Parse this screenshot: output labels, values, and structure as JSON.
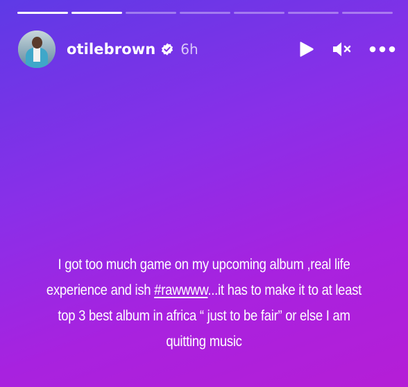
{
  "story": {
    "progress": {
      "segments": 7,
      "completed": 1,
      "active_index": 1,
      "active_fraction": 0.95
    },
    "user": {
      "username": "otilebrown",
      "verified": true,
      "time_ago": "6h"
    },
    "controls": {
      "play_icon": "play-icon",
      "mute_icon": "volume-muted-icon",
      "more_icon": "more-options-icon"
    },
    "caption": {
      "part1": "I got too much game on my  upcoming album  ,real life experience and ish ",
      "hashtag": "#rawwww",
      "part2": "...it has to make it to at least top 3 best album in africa “ just to be fair” or else I am quitting music"
    },
    "colors": {
      "gradient_top": "#5e3ae6",
      "gradient_bottom": "#b51ed6",
      "text": "#ffffff"
    }
  }
}
